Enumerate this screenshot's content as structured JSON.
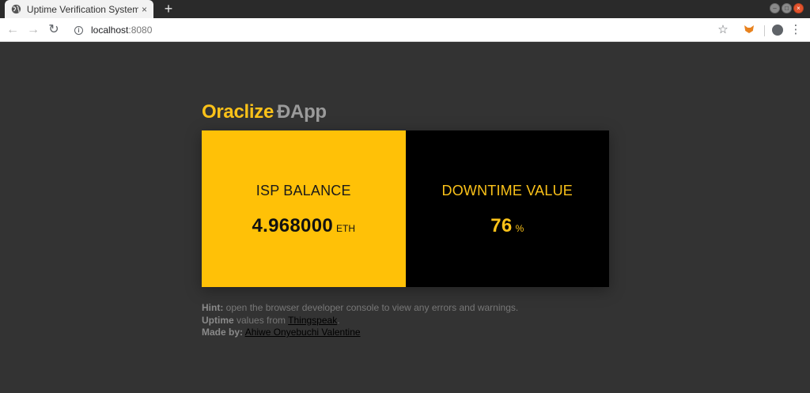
{
  "browser": {
    "tab_title": "Uptime Verification System",
    "tab_close": "×",
    "new_tab": "+",
    "url_host": "localhost",
    "url_port": ":8080",
    "back": "←",
    "forward": "→",
    "reload": "↻",
    "star": "☆",
    "menu": "⋮",
    "info": "i",
    "window_buttons": [
      "–",
      "□",
      "×"
    ]
  },
  "app": {
    "title_brand": "Oraclize",
    "title_rest": "ĐApp"
  },
  "cards": {
    "balance": {
      "label": "ISP BALANCE",
      "value": "4.968000",
      "unit": "ETH"
    },
    "downtime": {
      "label": "DOWNTIME VALUE",
      "value": "76",
      "unit": "%"
    }
  },
  "footer": {
    "hint_label": "Hint:",
    "hint_text": " open the browser developer console to view any errors and warnings.",
    "uptime_label": "Uptime",
    "uptime_text": " values from ",
    "uptime_link": "Thingspeak",
    "uptime_end": ".",
    "made_label": "Made by:",
    "made_link": "Ahiwe Onyebuchi Valentine"
  },
  "colors": {
    "brand_yellow": "#ffc107",
    "page_bg": "#333333",
    "card_dark": "#000000"
  }
}
